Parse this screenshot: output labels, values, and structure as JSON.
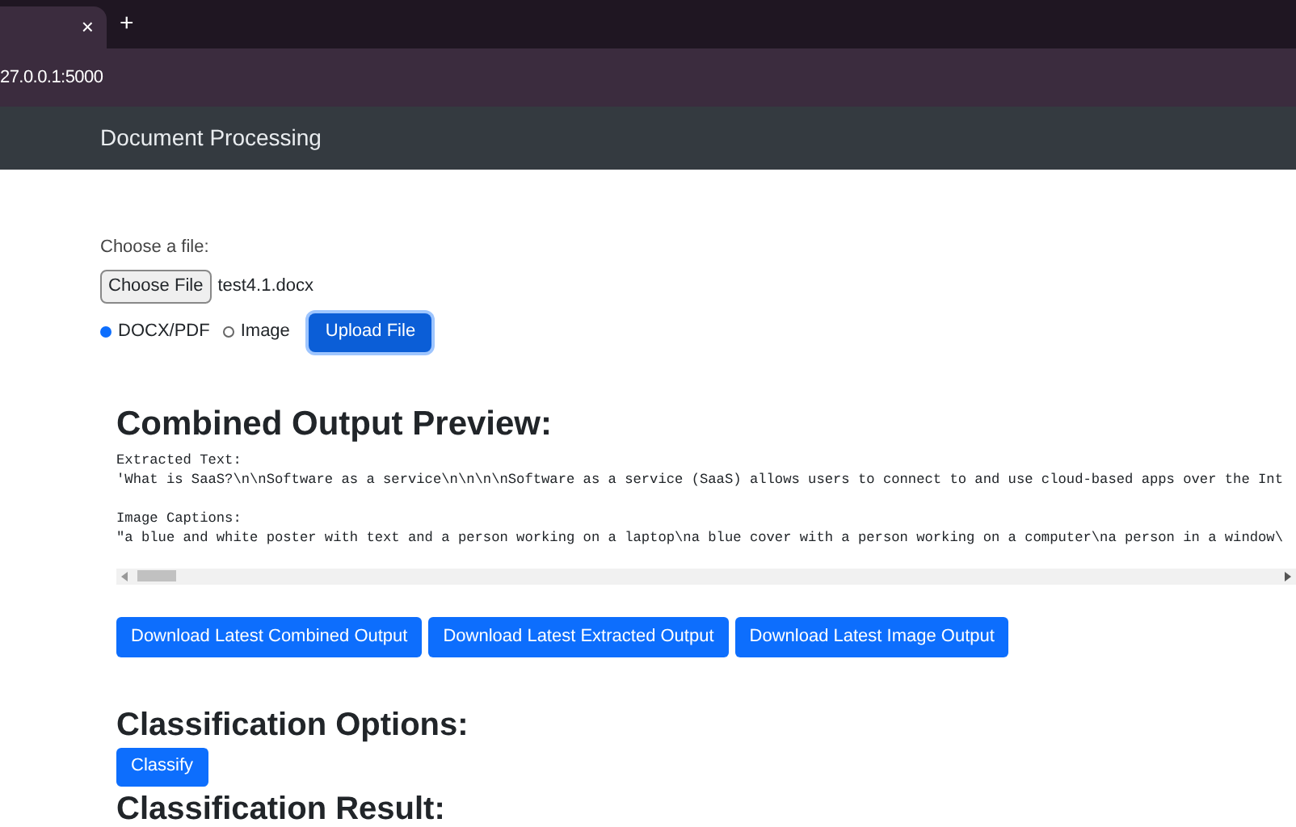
{
  "browser": {
    "tab_close": "×",
    "new_tab": "+",
    "address": "27.0.0.1:5000"
  },
  "navbar": {
    "title": "Document Processing"
  },
  "upload": {
    "label": "Choose a file:",
    "choose_button": "Choose File",
    "file_name": "test4.1.docx",
    "options": [
      {
        "label": "DOCX/PDF",
        "selected": true
      },
      {
        "label": "Image",
        "selected": false
      }
    ],
    "upload_button": "Upload File"
  },
  "preview": {
    "heading": "Combined Output Preview:",
    "blocks": [
      {
        "label": "Extracted Text:",
        "text": "'What is SaaS?\\n\\nSoftware as a service\\n\\n\\n\\nSoftware as a service (SaaS) allows users to connect to and use cloud-based apps over the Int"
      },
      {
        "label": "Image Captions:",
        "text": "\"a blue and white poster with text and a person working on a laptop\\na blue cover with a person working on a computer\\na person in a window\\"
      }
    ]
  },
  "downloads": [
    "Download Latest Combined Output",
    "Download Latest Extracted Output",
    "Download Latest Image Output"
  ],
  "classification": {
    "heading": "Classification Options:",
    "button": "Classify",
    "result_heading": "Classification Result:"
  }
}
